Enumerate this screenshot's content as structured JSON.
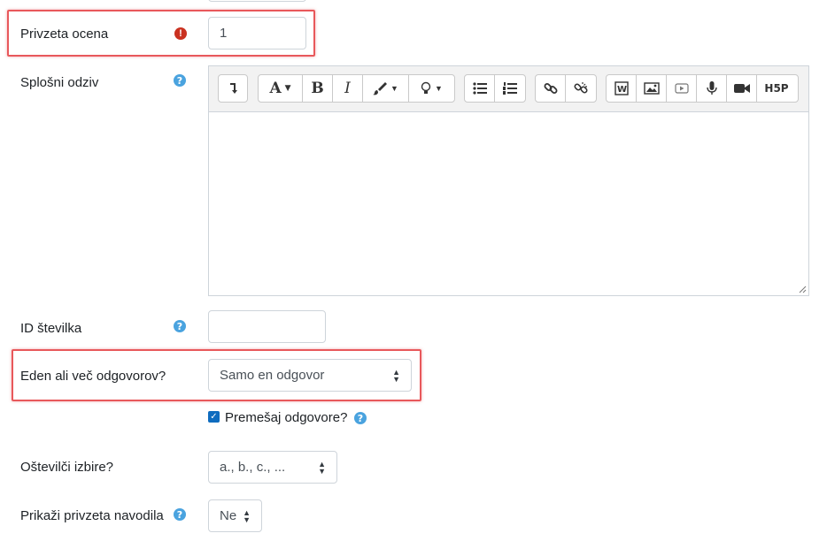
{
  "grade": {
    "label": "Privzeta ocena",
    "value": "1",
    "error_icon": "exclamation-icon",
    "color": "#ca3120"
  },
  "feedback": {
    "label": "Splošni odziv",
    "help_icon": "question-icon"
  },
  "editor": {
    "toolbar_buttons": [
      "collapse",
      "font",
      "bold",
      "italic",
      "brush",
      "light-bulb",
      "unordered-list",
      "ordered-list",
      "link",
      "unlink",
      "word",
      "image",
      "media",
      "record-audio",
      "record-video",
      "h5p"
    ],
    "bold_label": "B",
    "italic_label": "I",
    "font_label": "A",
    "h5p_label": "H5P"
  },
  "idnumber": {
    "label": "ID številka",
    "value": ""
  },
  "single": {
    "label": "Eden ali več odgovorov?",
    "value": "Samo en odgovor"
  },
  "shuffle": {
    "label": "Premešaj odgovore?",
    "checked": true
  },
  "numbering": {
    "label": "Oštevilči izbire?",
    "value": "a., b., c., ..."
  },
  "show_instructions": {
    "label": "Prikaži privzeta navodila",
    "value": "Ne"
  },
  "colors": {
    "highlight": "#e8585b",
    "help": "#4aa3df",
    "checkbox": "#0f6cbf"
  }
}
